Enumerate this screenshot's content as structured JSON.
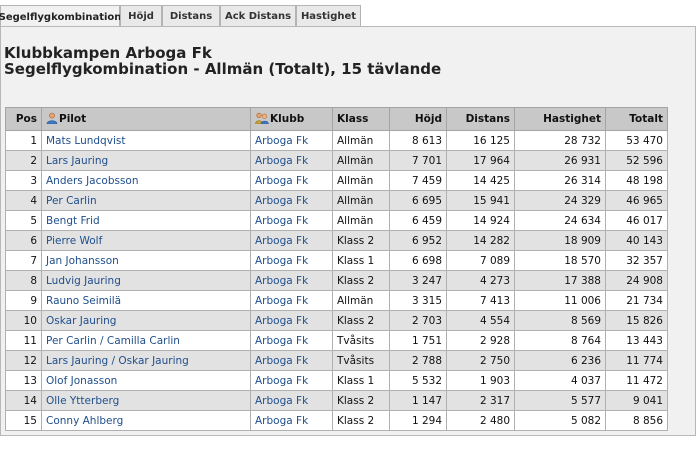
{
  "tabs": [
    "Segelflygkombination",
    "Höjd",
    "Distans",
    "Ack Distans",
    "Hastighet"
  ],
  "heading": {
    "line1": "Klubbkampen Arboga Fk",
    "line2": "Segelflygkombination - Allmän (Totalt), 15 tävlande"
  },
  "columns": {
    "pos": "Pos",
    "pilot": "Pilot",
    "klubb": "Klubb",
    "klass": "Klass",
    "hojd": "Höjd",
    "distans": "Distans",
    "hastighet": "Hastighet",
    "totalt": "Totalt"
  },
  "icons": {
    "pilot": "person-icon",
    "klubb": "club-icon"
  },
  "rows": [
    {
      "pos": "1",
      "pilot": "Mats Lundqvist",
      "klubb": "Arboga Fk",
      "klass": "Allmän",
      "hojd": "8 613",
      "distans": "16 125",
      "hastighet": "28 732",
      "totalt": "53 470"
    },
    {
      "pos": "2",
      "pilot": "Lars Jauring",
      "klubb": "Arboga Fk",
      "klass": "Allmän",
      "hojd": "7 701",
      "distans": "17 964",
      "hastighet": "26 931",
      "totalt": "52 596"
    },
    {
      "pos": "3",
      "pilot": "Anders Jacobsson",
      "klubb": "Arboga Fk",
      "klass": "Allmän",
      "hojd": "7 459",
      "distans": "14 425",
      "hastighet": "26 314",
      "totalt": "48 198"
    },
    {
      "pos": "4",
      "pilot": "Per Carlin",
      "klubb": "Arboga Fk",
      "klass": "Allmän",
      "hojd": "6 695",
      "distans": "15 941",
      "hastighet": "24 329",
      "totalt": "46 965"
    },
    {
      "pos": "5",
      "pilot": "Bengt Frid",
      "klubb": "Arboga Fk",
      "klass": "Allmän",
      "hojd": "6 459",
      "distans": "14 924",
      "hastighet": "24 634",
      "totalt": "46 017"
    },
    {
      "pos": "6",
      "pilot": "Pierre Wolf",
      "klubb": "Arboga Fk",
      "klass": "Klass 2",
      "hojd": "6 952",
      "distans": "14 282",
      "hastighet": "18 909",
      "totalt": "40 143"
    },
    {
      "pos": "7",
      "pilot": "Jan Johansson",
      "klubb": "Arboga Fk",
      "klass": "Klass 1",
      "hojd": "6 698",
      "distans": "7 089",
      "hastighet": "18 570",
      "totalt": "32 357"
    },
    {
      "pos": "8",
      "pilot": "Ludvig Jauring",
      "klubb": "Arboga Fk",
      "klass": "Klass 2",
      "hojd": "3 247",
      "distans": "4 273",
      "hastighet": "17 388",
      "totalt": "24 908"
    },
    {
      "pos": "9",
      "pilot": "Rauno Seimilä",
      "klubb": "Arboga Fk",
      "klass": "Allmän",
      "hojd": "3 315",
      "distans": "7 413",
      "hastighet": "11 006",
      "totalt": "21 734"
    },
    {
      "pos": "10",
      "pilot": "Oskar Jauring",
      "klubb": "Arboga Fk",
      "klass": "Klass 2",
      "hojd": "2 703",
      "distans": "4 554",
      "hastighet": "8 569",
      "totalt": "15 826"
    },
    {
      "pos": "11",
      "pilot": "Per Carlin / Camilla Carlin",
      "klubb": "Arboga Fk",
      "klass": "Tvåsits",
      "hojd": "1 751",
      "distans": "2 928",
      "hastighet": "8 764",
      "totalt": "13 443"
    },
    {
      "pos": "12",
      "pilot": "Lars Jauring / Oskar Jauring",
      "klubb": "Arboga Fk",
      "klass": "Tvåsits",
      "hojd": "2 788",
      "distans": "2 750",
      "hastighet": "6 236",
      "totalt": "11 774"
    },
    {
      "pos": "13",
      "pilot": "Olof Jonasson",
      "klubb": "Arboga Fk",
      "klass": "Klass 1",
      "hojd": "5 532",
      "distans": "1 903",
      "hastighet": "4 037",
      "totalt": "11 472"
    },
    {
      "pos": "14",
      "pilot": "Olle Ytterberg",
      "klubb": "Arboga Fk",
      "klass": "Klass 2",
      "hojd": "1 147",
      "distans": "2 317",
      "hastighet": "5 577",
      "totalt": "9 041"
    },
    {
      "pos": "15",
      "pilot": "Conny Ahlberg",
      "klubb": "Arboga Fk",
      "klass": "Klass 2",
      "hojd": "1 294",
      "distans": "2 480",
      "hastighet": "5 082",
      "totalt": "8 856"
    }
  ]
}
